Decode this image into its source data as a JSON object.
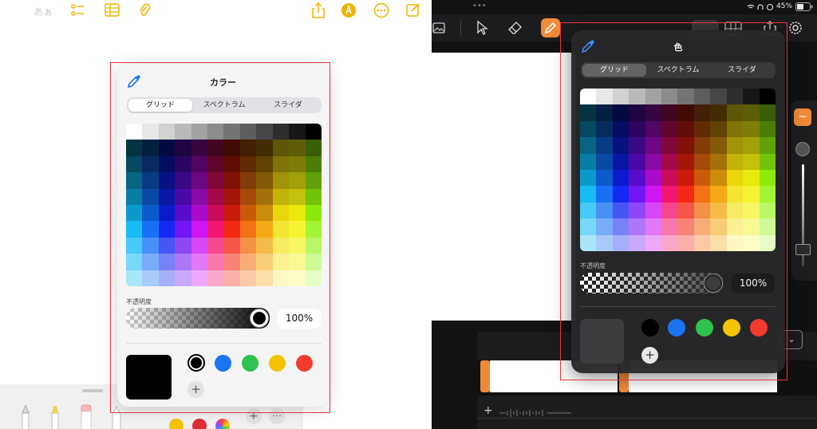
{
  "left": {
    "toolbar": {
      "text_format_label": "あぁ"
    },
    "panel": {
      "title": "カラー",
      "tabs": [
        "グリッド",
        "スペクトラム",
        "スライダ"
      ],
      "opacity_label": "不透明度",
      "opacity_value": "100%",
      "current_color": "#000000",
      "swatches": [
        "#000000",
        "#1a73f0",
        "#2fc24e",
        "#f5c400",
        "#f43b30"
      ]
    }
  },
  "right": {
    "status": {
      "battery": "45%"
    },
    "panel": {
      "title": "色",
      "tabs": [
        "グリッド",
        "スペクトラム",
        "スライダ"
      ],
      "opacity_label": "不透明度",
      "opacity_value": "100%",
      "current_color": "#3c3c3e",
      "swatches": [
        "#000000",
        "#1a73f0",
        "#2fc24e",
        "#f5c400",
        "#f43b30"
      ]
    },
    "accent": "#f08a3a"
  }
}
